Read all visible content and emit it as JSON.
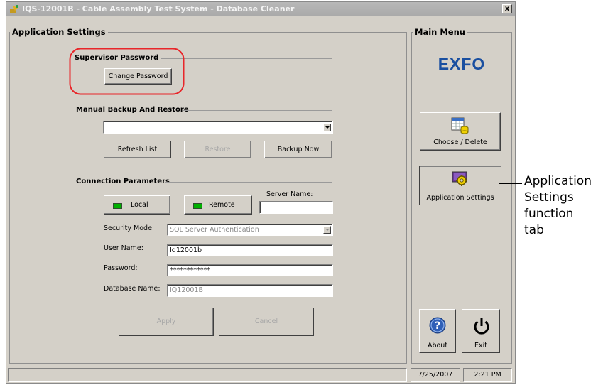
{
  "window": {
    "title": "IQS-12001B - Cable Assembly Test System - Database Cleaner",
    "close_label": "x"
  },
  "app_settings": {
    "title": "Application Settings",
    "supervisor": {
      "heading": "Supervisor Password",
      "change_password_label": "Change Password"
    },
    "backup": {
      "heading": "Manual Backup And Restore",
      "backup_select_value": "",
      "refresh_label": "Refresh List",
      "restore_label": "Restore",
      "backup_now_label": "Backup Now"
    },
    "connection": {
      "heading": "Connection Parameters",
      "local_label": "Local",
      "remote_label": "Remote",
      "server_name_label": "Server Name:",
      "server_name_value": "",
      "security_mode_label": "Security Mode:",
      "security_mode_value": "SQL Server Authentication",
      "user_name_label": "User Name:",
      "user_name_value": "Iq12001b",
      "password_label": "Password:",
      "password_value": "************",
      "database_name_label": "Database Name:",
      "database_name_value": "IQ12001B"
    },
    "apply_label": "Apply",
    "cancel_label": "Cancel"
  },
  "main_menu": {
    "title": "Main Menu",
    "logo_text": "EXFO",
    "choose_delete_label": "Choose / Delete",
    "application_settings_label": "Application Settings",
    "about_label": "About",
    "exit_label": "Exit"
  },
  "statusbar": {
    "message": "",
    "date": "7/25/2007",
    "time": "2:21 PM"
  },
  "annotation": {
    "lines": [
      "Application",
      "Settings",
      "function",
      "tab"
    ]
  },
  "colors": {
    "window_bg": "#d4d0c8",
    "highlight_circle": "#e8262a",
    "logo": "#1a4fa0",
    "led_green": "#00b000",
    "help_icon": "#2f5fb7"
  }
}
